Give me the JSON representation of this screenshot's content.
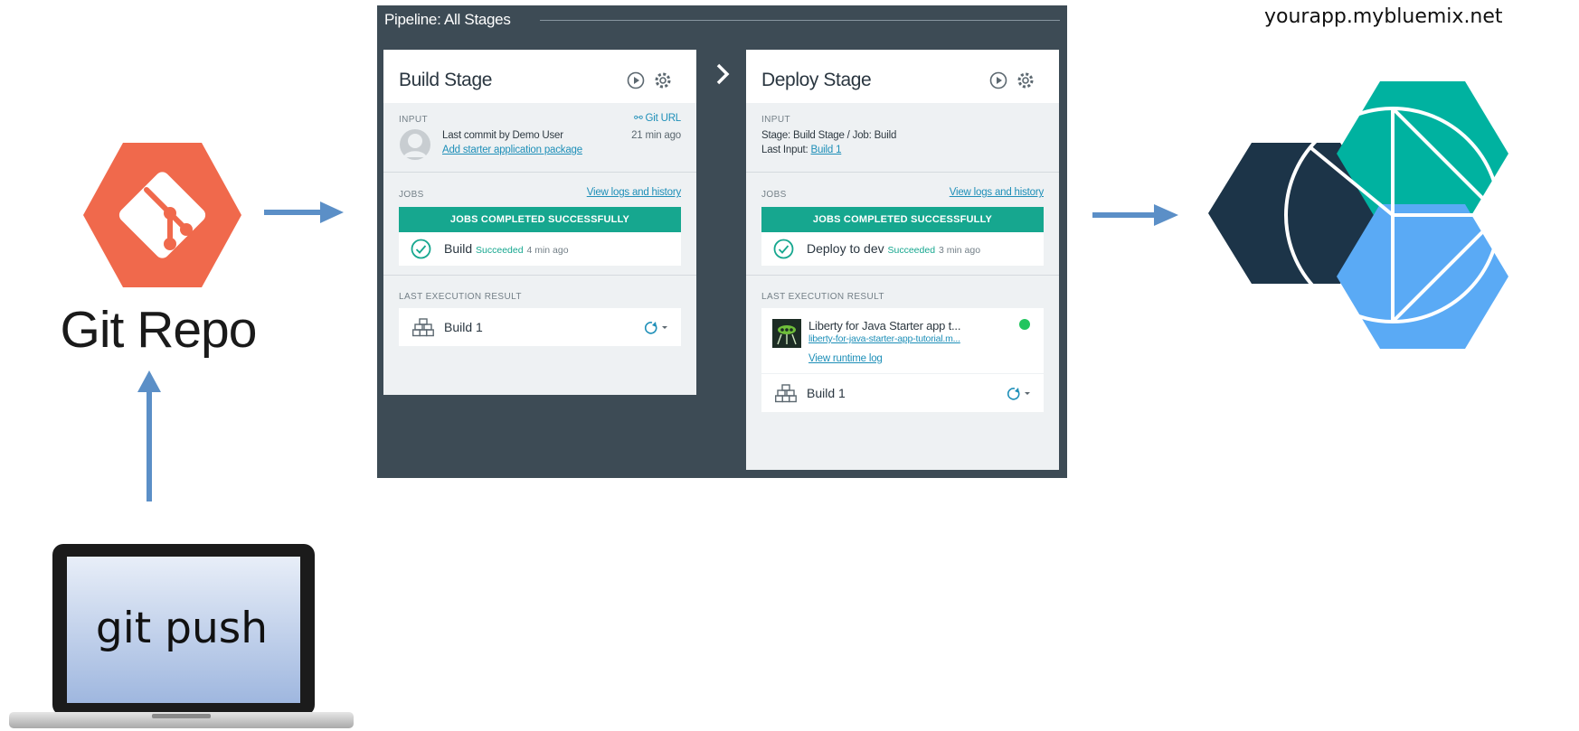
{
  "git": {
    "repo_label": "Git Repo",
    "laptop_text": "git push",
    "logo_color": "#f0694c"
  },
  "pipeline": {
    "title": "Pipeline: All Stages",
    "stages": [
      {
        "title": "Build Stage",
        "input": {
          "label": "INPUT",
          "git_url": "Git URL",
          "commit_line": "Last commit by Demo User",
          "commit_link": "Add starter application package",
          "time": "21 min ago"
        },
        "jobs": {
          "label": "JOBS",
          "logs_link": "View logs and history",
          "banner": "JOBS COMPLETED SUCCESSFULLY",
          "job_name": "Build",
          "job_status": "Succeeded",
          "job_time": "4 min ago"
        },
        "last_result": {
          "label": "LAST EXECUTION RESULT",
          "build": "Build 1"
        }
      },
      {
        "title": "Deploy Stage",
        "input": {
          "label": "INPUT",
          "stage_line": "Stage: Build Stage  /  Job: Build",
          "last_input_prefix": "Last Input:",
          "last_input_link": "Build 1"
        },
        "jobs": {
          "label": "JOBS",
          "logs_link": "View logs and history",
          "banner": "JOBS COMPLETED SUCCESSFULLY",
          "job_name": "Deploy to dev",
          "job_status": "Succeeded",
          "job_time": "3 min ago"
        },
        "last_result": {
          "label": "LAST EXECUTION RESULT",
          "app_name": "Liberty for Java Starter app t...",
          "app_route": "liberty-for-java-starter-app-tutorial.m...",
          "runtime_log": "View runtime log",
          "build": "Build 1"
        }
      }
    ],
    "colors": {
      "panel": "#3d4b55",
      "success": "#16a78f",
      "link": "#1e8fb8",
      "status_dot": "#22c55e"
    }
  },
  "bluemix": {
    "app_url": "yourapp.mybluemix.net",
    "colors": {
      "teal": "#00b2a0",
      "navy": "#1c3448",
      "blue": "#5aaaf5"
    }
  },
  "arrow_color": "#5b8fc7"
}
